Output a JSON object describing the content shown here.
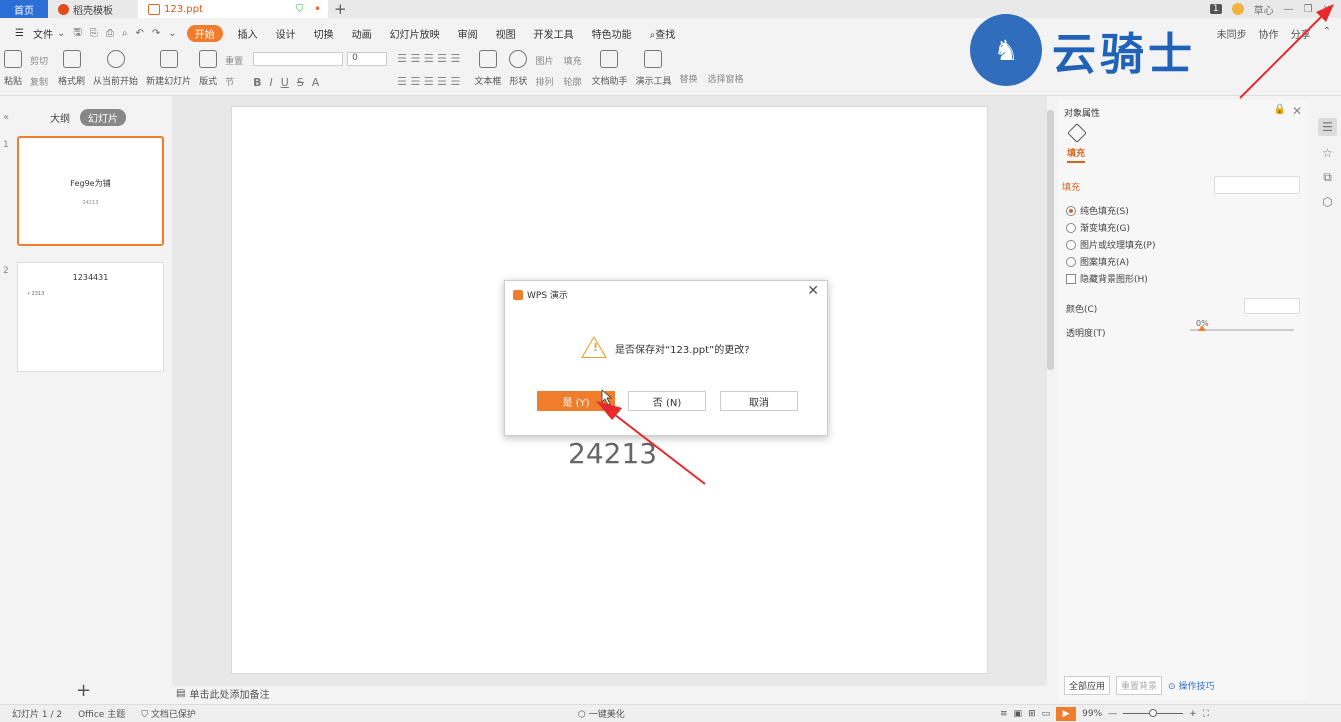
{
  "tabs": {
    "home": "首页",
    "template": "稻壳模板",
    "doc": "123.ppt",
    "plus": "+"
  },
  "window": {
    "badge": "1",
    "user": "草心"
  },
  "menu": {
    "file": "文件",
    "items": [
      "开始",
      "插入",
      "设计",
      "切换",
      "动画",
      "幻灯片放映",
      "审阅",
      "视图",
      "开发工具",
      "特色功能"
    ],
    "search": "查找",
    "right": [
      "未同步",
      "协作",
      "分享"
    ]
  },
  "ribbon": {
    "paste": "粘贴",
    "cut": "剪切",
    "copy": "复制",
    "format_painter": "格式刷",
    "from_start": "从当前开始",
    "new_slide": "新建幻灯片",
    "layout": "版式",
    "reset": "重置",
    "section": "节",
    "font_size": "0",
    "textbox": "文本框",
    "shape": "形状",
    "picture": "图片",
    "arrange": "排列",
    "fill": "填充",
    "outline": "轮廓",
    "doc_helper": "文档助手",
    "present_tools": "演示工具",
    "replace": "替换",
    "select_pane": "选择窗格"
  },
  "watermark": {
    "text": "云骑士"
  },
  "leftpanel": {
    "outline": "大纲",
    "slides": "幻灯片",
    "slide1": {
      "num": "1",
      "title": "Feg9e为铺",
      "sub": "24213"
    },
    "slide2": {
      "num": "2",
      "title": "1234431",
      "bullet": "• 2313"
    }
  },
  "slide": {
    "text": "24213"
  },
  "notes": {
    "placeholder": "单击此处添加备注"
  },
  "rightpanel": {
    "title": "对象属性",
    "tab": "填充",
    "section": "填充",
    "options": [
      "纯色填充(S)",
      "渐变填充(G)",
      "图片或纹理填充(P)",
      "图案填充(A)"
    ],
    "hide_bg": "隐藏背景图形(H)",
    "color": "颜色(C)",
    "transparency": "透明度(T)",
    "transparency_value": "0%",
    "apply_all": "全部应用",
    "reset_bg": "重置背景",
    "tips": "操作技巧"
  },
  "dialog": {
    "title": "WPS 演示",
    "message": "是否保存对“123.ppt”的更改?",
    "yes": "是 (Y)",
    "no": "否 (N)",
    "cancel": "取消"
  },
  "status": {
    "slide_count": "幻灯片 1 / 2",
    "theme": "Office 主题",
    "protected": "文档已保护",
    "beautify": "一键美化",
    "zoom": "99%"
  },
  "colors": {
    "accent": "#ef7d2c",
    "home_tab": "#2b6fd6",
    "annotation": "#e8282b",
    "watermark": "#2062b8"
  }
}
